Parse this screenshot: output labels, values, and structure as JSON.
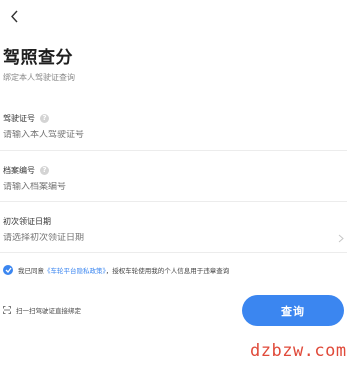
{
  "header": {
    "back_icon": "chevron-left-icon"
  },
  "page": {
    "title": "驾照查分",
    "subtitle": "绑定本人驾驶证查询"
  },
  "fields": {
    "license_number": {
      "label": "驾驶证号",
      "placeholder": "请输入本人驾驶证号",
      "help_icon": "help-icon"
    },
    "file_number": {
      "label": "档案编号",
      "placeholder": "请输入档案编号",
      "help_icon": "help-icon"
    },
    "issue_date": {
      "label": "初次领证日期",
      "placeholder": "请选择初次领证日期",
      "chevron_icon": "chevron-right-icon"
    }
  },
  "agreement": {
    "prefix": "我已同意",
    "link": "《车轮平台隐私政策》",
    "suffix": "，授权车轮使用我的个人信息用于违章查询"
  },
  "scan": {
    "label": "扫一扫驾驶证直接绑定"
  },
  "actions": {
    "query_label": "查询"
  },
  "watermark": "dzbzw.com",
  "colors": {
    "accent": "#3b86f0",
    "watermark": "#e04a3a"
  }
}
